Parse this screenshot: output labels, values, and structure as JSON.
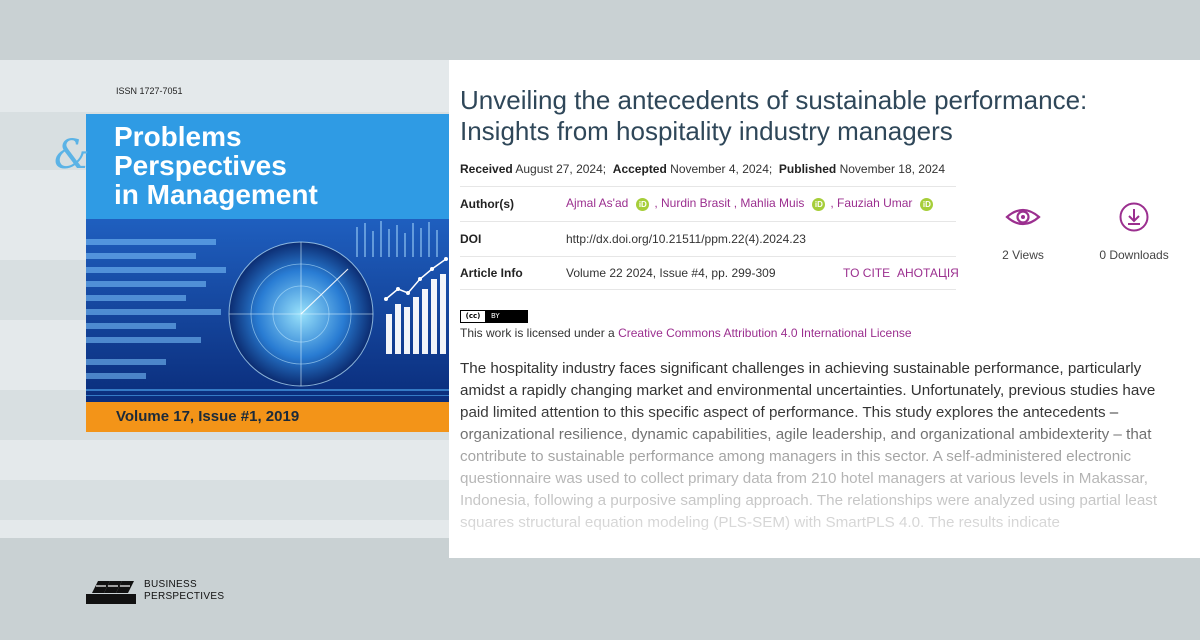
{
  "cover": {
    "issn": "ISSN 1727-7051",
    "ampersand": "&",
    "title_lines": [
      "Problems",
      "Perspectives",
      "in Management"
    ],
    "volume": "Volume 17, Issue #1, 2019"
  },
  "publisher": {
    "line1": "BUSINESS",
    "line2": "PERSPECTIVES"
  },
  "article": {
    "title": "Unveiling the antecedents of sustainable performance: Insights from hospitality industry managers",
    "dates": {
      "received_label": "Received",
      "received": "August 27, 2024;",
      "accepted_label": "Accepted",
      "accepted": "November 4, 2024;",
      "published_label": "Published",
      "published": "November 18, 2024"
    },
    "authors_label": "Author(s)",
    "authors": [
      "Ajmal As'ad",
      ", Nurdin Brasit",
      ", Mahlia Muis",
      ", Fauziah Umar"
    ],
    "orcid_glyph": "iD",
    "doi_label": "DOI",
    "doi": "http://dx.doi.org/10.21511/ppm.22(4).2024.23",
    "info_label": "Article Info",
    "info": "Volume 22 2024, Issue #4, pp. 299-309",
    "to_cite": "TO CITE",
    "annotation": "АНОТАЦІЯ",
    "views": "2 Views",
    "downloads": "0 Downloads",
    "cc_badge_left": "(cc)",
    "cc_badge_right": "BY",
    "license_prefix": "This work is licensed under a ",
    "license_link": "Creative Commons Attribution 4.0 International License",
    "abstract": "The hospitality industry faces significant challenges in achieving sustainable performance, particularly amidst a rapidly changing market and environmental uncertainties. Unfortunately, previous studies have paid limited attention to this specific aspect of performance. This study explores the antecedents – organizational resilience, dynamic capabilities, agile leadership, and organizational ambidexterity – that contribute to sustainable performance among managers in this sector. A self-administered electronic questionnaire was used to collect primary data from 210 hotel managers at various levels in Makassar, Indonesia, following a purposive sampling approach. The relationships were analyzed using partial least squares structural equation modeling (PLS-SEM) with SmartPLS 4.0. The results indicate"
  },
  "icons": {
    "views": "eye-icon",
    "downloads": "download-icon"
  },
  "colors": {
    "link": "#9b2f8f",
    "title": "#2f4759",
    "cover_blue": "#2f9be4",
    "cover_orange": "#f39418",
    "orcid": "#a6ce39"
  }
}
